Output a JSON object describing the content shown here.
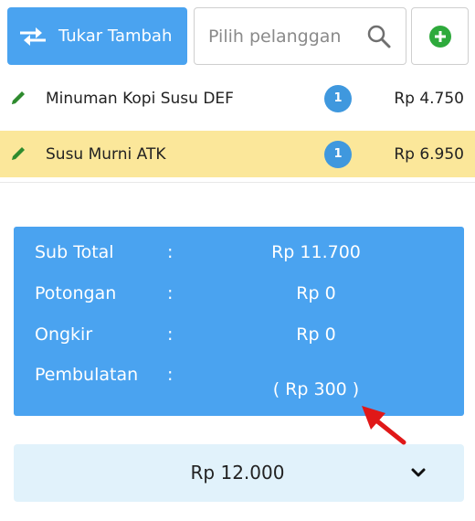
{
  "topbar": {
    "swap_label": "Tukar Tambah",
    "search_placeholder": "Pilih pelanggan"
  },
  "items": [
    {
      "name": "Minuman Kopi Susu DEF",
      "qty": "1",
      "price": "Rp 4.750"
    },
    {
      "name": "Susu Murni ATK",
      "qty": "1",
      "price": "Rp 6.950"
    }
  ],
  "summary": {
    "subtotal_label": "Sub Total",
    "subtotal_value": "Rp 11.700",
    "discount_label": "Potongan",
    "discount_value": "Rp 0",
    "shipping_label": "Ongkir",
    "shipping_value": "Rp 0",
    "rounding_label": "Pembulatan",
    "rounding_value": "( Rp 300 )",
    "colon": ":"
  },
  "total": {
    "amount": "Rp 12.000"
  },
  "colors": {
    "primary": "#4aa3f0",
    "highlight": "#fbe79a",
    "badge": "#3f98de",
    "add": "#2eaa3c",
    "edit": "#2e8b2e",
    "total_bg": "#e1f2fb",
    "annotation_arrow": "#e01818"
  },
  "icons": [
    "swap-arrows-icon",
    "search-icon",
    "plus-circle-icon",
    "pencil-icon",
    "chevron-down-icon"
  ]
}
